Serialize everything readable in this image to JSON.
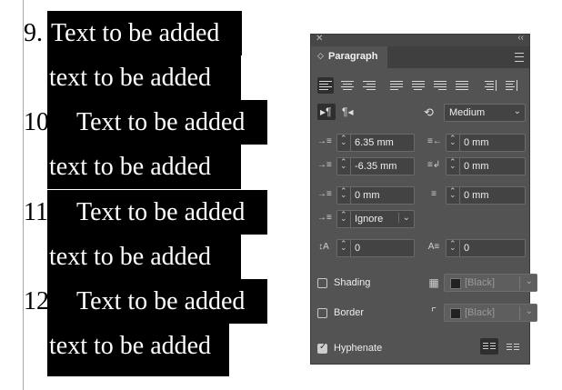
{
  "document": {
    "lines": [
      {
        "num": "9.",
        "text": "Text to be added"
      },
      {
        "num": "",
        "text": "text to be added"
      },
      {
        "num": "10.",
        "text": "Text to be added"
      },
      {
        "num": "",
        "text": "text to be added"
      },
      {
        "num": "11.",
        "text": "Text to be added"
      },
      {
        "num": "",
        "text": "text to be added"
      },
      {
        "num": "12.",
        "text": "Text to be added"
      },
      {
        "num": "",
        "text": "text to be added"
      }
    ]
  },
  "panel": {
    "title": "Paragraph",
    "justification": {
      "selected": "align-left"
    },
    "composer": "Medium",
    "left_indent": "6.35 mm",
    "right_indent": "0 mm",
    "first_line_indent": "-6.35 mm",
    "last_line_right_indent": "0 mm",
    "space_before": "0 mm",
    "space_after": "0 mm",
    "align_to_grid": "Ignore",
    "drop_cap_lines": "0",
    "drop_cap_chars": "0",
    "shading_label": "Shading",
    "shading_swatch": "[Black]",
    "shading_checked": false,
    "border_label": "Border",
    "border_swatch": "[Black]",
    "border_checked": false,
    "hyphenate_label": "Hyphenate",
    "hyphenate_checked": true,
    "colors": {
      "panel": "#535353",
      "field": "#434343",
      "text": "#e6e6e6",
      "highlight": "#000000",
      "guide": "#7fb8d6"
    }
  }
}
